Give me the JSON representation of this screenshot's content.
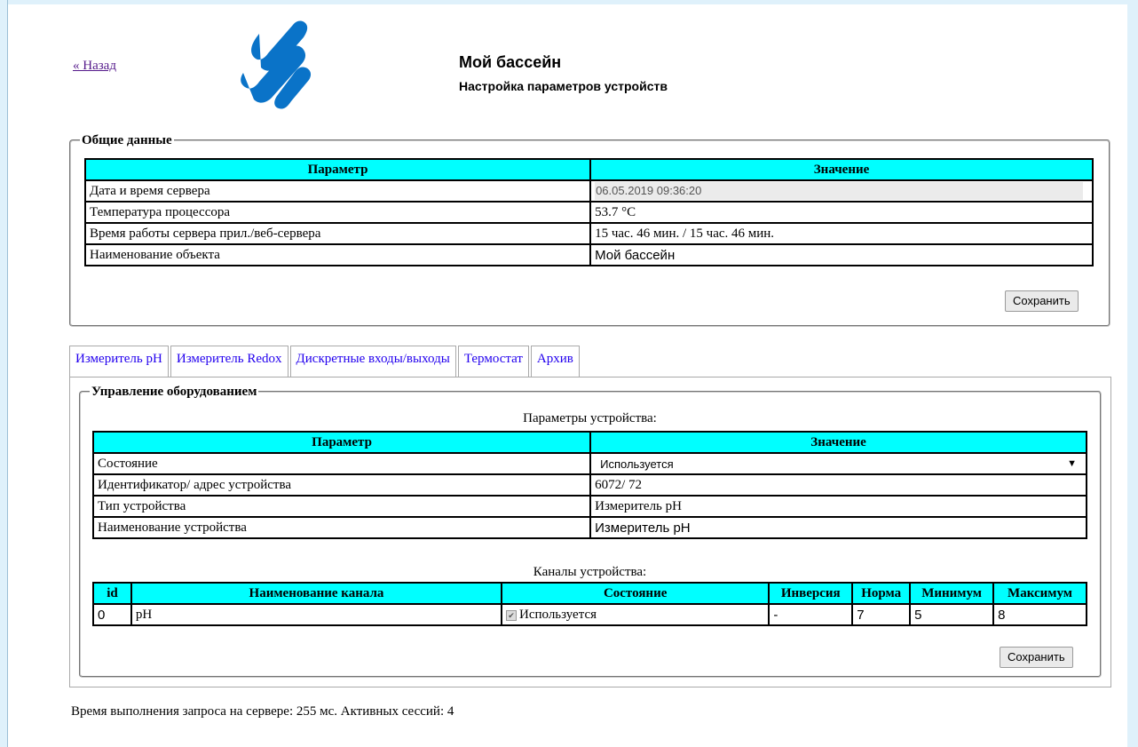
{
  "header": {
    "back_link": "« Назад",
    "title": "Мой бассейн",
    "subtitle": "Настройка параметров устройств",
    "logo_icon": "bluewave-logo-icon"
  },
  "general": {
    "legend": "Общие данные",
    "columns": [
      "Параметр",
      "Значение"
    ],
    "rows": [
      {
        "param": "Дата и время сервера",
        "value": "06.05.2019 09:36:20"
      },
      {
        "param": "Температура процессора",
        "value": "53.7 °C"
      },
      {
        "param": "Время работы сервера прил./веб-сервера",
        "value": "15 час. 46 мин. / 15 час. 46 мин."
      },
      {
        "param": "Наименование объекта",
        "value": "Мой бассейн"
      }
    ],
    "save_label": "Сохранить"
  },
  "tabs": [
    {
      "label": "Измеритель pH",
      "active": true
    },
    {
      "label": "Измеритель Redox",
      "active": false
    },
    {
      "label": "Дискретные входы/выходы",
      "active": false
    },
    {
      "label": "Термостат",
      "active": false
    },
    {
      "label": "Архив",
      "active": false
    }
  ],
  "equipment": {
    "legend": "Управление оборудованием",
    "params_caption": "Параметры устройства:",
    "columns": [
      "Параметр",
      "Значение"
    ],
    "rows": [
      {
        "param": "Состояние",
        "value": "Используется"
      },
      {
        "param": "Идентификатор/ адрес устройства",
        "value": "6072/ 72"
      },
      {
        "param": "Тип устройства",
        "value": "Измеритель pH"
      },
      {
        "param": "Наименование устройства",
        "value": "Измеритель pH"
      }
    ],
    "channels_caption": "Каналы устройства:",
    "channel_columns": [
      "id",
      "Наименование канала",
      "Состояние",
      "Инверсия",
      "Норма",
      "Минимум",
      "Максимум"
    ],
    "channels": [
      {
        "id": "0",
        "name": "pH",
        "state": "Используется",
        "checked": true,
        "inversion": "-",
        "norm": "7",
        "min": "5",
        "max": "8"
      }
    ],
    "save_label": "Сохранить"
  },
  "footer": {
    "text": "Время выполнения запроса на сервере: 255 мс. Активных сессий: 4"
  }
}
